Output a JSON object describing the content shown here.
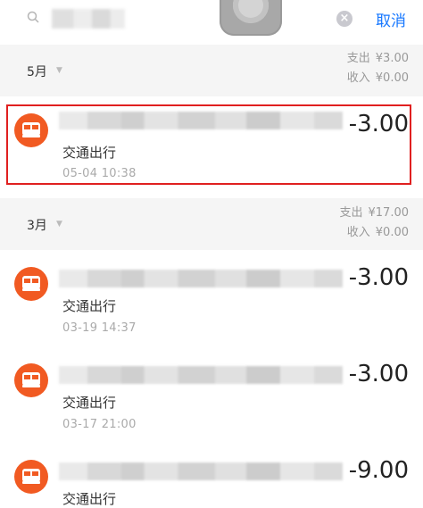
{
  "header": {
    "cancel_label": "取消",
    "clear_icon": "×"
  },
  "sections": [
    {
      "month": "5月",
      "summary": {
        "expense_label": "支出",
        "expense": "¥3.00",
        "income_label": "收入",
        "income": "¥0.00"
      },
      "transactions": [
        {
          "amount": "-3.00",
          "category": "交通出行",
          "time": "05-04  10:38",
          "highlighted": true
        }
      ]
    },
    {
      "month": "3月",
      "summary": {
        "expense_label": "支出",
        "expense": "¥17.00",
        "income_label": "收入",
        "income": "¥0.00"
      },
      "transactions": [
        {
          "amount": "-3.00",
          "category": "交通出行",
          "time": "03-19  14:37"
        },
        {
          "amount": "-3.00",
          "category": "交通出行",
          "time": "03-17  21:00"
        },
        {
          "amount": "-9.00",
          "category": "交通出行",
          "time": ""
        }
      ]
    }
  ],
  "colors": {
    "accent": "#1677ff",
    "icon_bg": "#f15a22",
    "highlight": "#e02020"
  },
  "icons": {
    "search": "search-icon",
    "transport": "bus-icon",
    "clear": "clear-icon"
  }
}
